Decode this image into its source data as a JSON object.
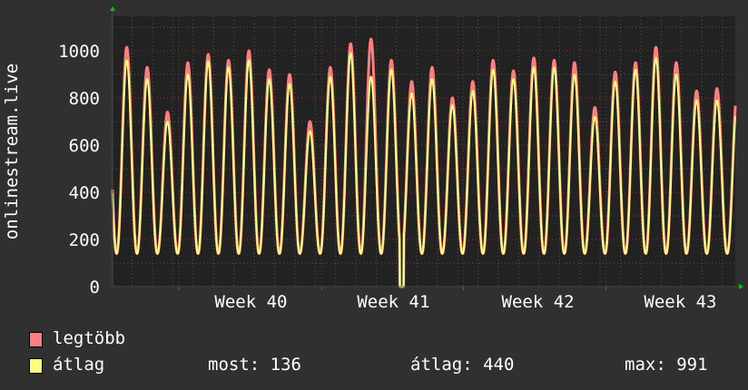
{
  "chart_data": {
    "type": "line",
    "ylabel": "onlinestream.live",
    "ylim": [
      0,
      1100
    ],
    "yticks": [
      0,
      200,
      400,
      600,
      800,
      1000
    ],
    "xlim_days": [
      0,
      30.6
    ],
    "xtick_labels": [
      {
        "label": "Week 40",
        "day": 6.8
      },
      {
        "label": "Week 41",
        "day": 13.8
      },
      {
        "label": "Week 42",
        "day": 20.9
      },
      {
        "label": "Week 43",
        "day": 27.9
      }
    ],
    "week_boundaries_days": [
      3.26,
      10.27,
      17.23,
      24.24
    ],
    "grid": true,
    "trough": 140,
    "series": [
      {
        "name": "legtöbb",
        "color": "#ff7f7f",
        "daily_peaks": [
          1015,
          930,
          740,
          950,
          985,
          960,
          1000,
          920,
          900,
          700,
          930,
          1030,
          1050,
          960,
          870,
          930,
          800,
          870,
          960,
          915,
          970,
          960,
          950,
          760,
          910,
          950,
          1015,
          950,
          830,
          840
        ]
      },
      {
        "name": "átlag",
        "color": "#ffff7f",
        "daily_peaks": [
          960,
          880,
          700,
          900,
          955,
          930,
          960,
          880,
          860,
          660,
          890,
          990,
          890,
          920,
          820,
          880,
          770,
          830,
          920,
          880,
          930,
          930,
          900,
          720,
          870,
          920,
          970,
          900,
          790,
          790
        ]
      }
    ],
    "dropout_day": 14.2,
    "legend": {
      "items": [
        "legtöbb",
        "átlag"
      ],
      "stats": {
        "most": "most: 136",
        "atlag": "átlag: 440",
        "max": "max: 991"
      }
    }
  }
}
